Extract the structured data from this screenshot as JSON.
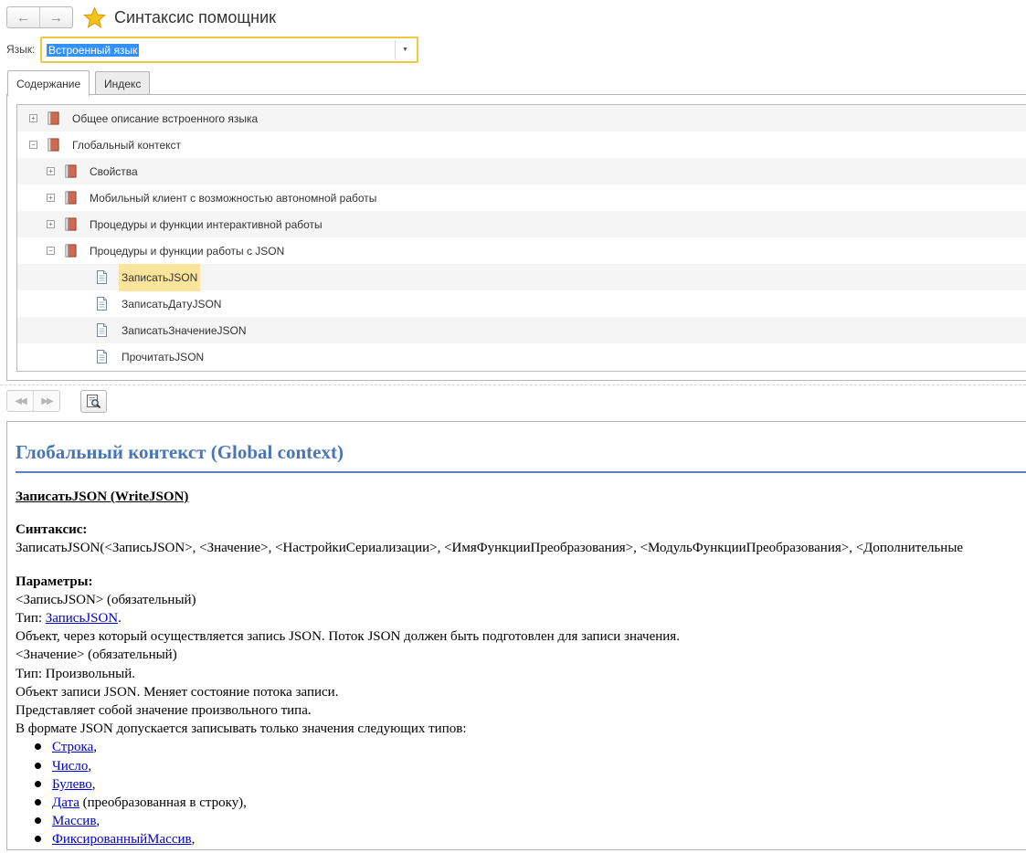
{
  "window": {
    "title": "Синтаксис помощник"
  },
  "nav": {
    "back_glyph": "←",
    "forward_glyph": "→"
  },
  "language": {
    "label": "Язык:",
    "value": "Встроенный язык",
    "dropdown_glyph": "▼"
  },
  "tabs": [
    {
      "label": "Содержание",
      "active": true
    },
    {
      "label": "Индекс",
      "active": false
    }
  ],
  "tree": {
    "items": [
      {
        "label": "Общее описание встроенного языка",
        "level": 0,
        "expander": "⊕",
        "icon": "book-icon"
      },
      {
        "label": "Глобальный контекст",
        "level": 0,
        "expander": "⊖",
        "icon": "book-icon"
      },
      {
        "label": "Свойства",
        "level": 1,
        "expander": "⊕",
        "icon": "book-icon"
      },
      {
        "label": "Мобильный клиент с возможностью автономной работы",
        "level": 1,
        "expander": "⊕",
        "icon": "book-icon"
      },
      {
        "label": "Процедуры и функции интерактивной работы",
        "level": 1,
        "expander": "⊕",
        "icon": "book-icon"
      },
      {
        "label": "Процедуры и функции работы с JSON",
        "level": 1,
        "expander": "⊖",
        "icon": "book-icon"
      },
      {
        "label": "ЗаписатьJSON",
        "level": 2,
        "expander": "",
        "icon": "page-icon",
        "selected": true
      },
      {
        "label": "ЗаписатьДатуJSON",
        "level": 2,
        "expander": "",
        "icon": "page-icon"
      },
      {
        "label": "ЗаписатьЗначениеJSON",
        "level": 2,
        "expander": "",
        "icon": "page-icon"
      },
      {
        "label": "ПрочитатьJSON",
        "level": 2,
        "expander": "",
        "icon": "page-icon"
      }
    ]
  },
  "toolbar": {
    "prev_glyph": "◀◀",
    "next_glyph": "▶▶",
    "find_icon": "find-in-tree-icon"
  },
  "content": {
    "title": "Глобальный контекст (Global context)",
    "function_name": "ЗаписатьJSON (WriteJSON)",
    "syntax_heading": "Синтаксис:",
    "syntax": "ЗаписатьJSON(<ЗаписьJSON>, <Значение>, <НастройкиСериализации>, <ИмяФункцииПреобразования>, <МодульФункцииПреобразования>, <Дополнительные",
    "params_heading": "Параметры:",
    "p1_name": "<ЗаписьJSON> (обязательный)",
    "p1_type_prefix": "Тип: ",
    "p1_type_link": "ЗаписьJSON",
    "p1_type_suffix": ".",
    "p1_desc": "Объект, через который осуществляется запись JSON. Поток JSON должен быть подготовлен для записи значения.",
    "p2_name": "<Значение> (обязательный)",
    "p2_type": "Тип: Произвольный.",
    "p2_desc1": "Объект записи JSON. Меняет состояние потока записи.",
    "p2_desc2": "Представляет собой значение произвольного типа.",
    "p2_desc3": "В формате JSON допускается записывать только значения следующих типов:",
    "types": [
      {
        "link": "Строка",
        "suffix": ","
      },
      {
        "link": "Число",
        "suffix": ","
      },
      {
        "link": "Булево",
        "suffix": ","
      },
      {
        "link": "Дата",
        "suffix": " (преобразованная в строку),"
      },
      {
        "link": "Массив",
        "suffix": ","
      },
      {
        "link": "ФиксированныйМассив",
        "suffix": ","
      }
    ]
  },
  "colors": {
    "accent_yellow": "#f0c846",
    "selection_bg": "#fbe59a",
    "heading_blue": "#4a76b5",
    "link_blue": "#0000cc",
    "book_icon_red": "#c0392b"
  }
}
